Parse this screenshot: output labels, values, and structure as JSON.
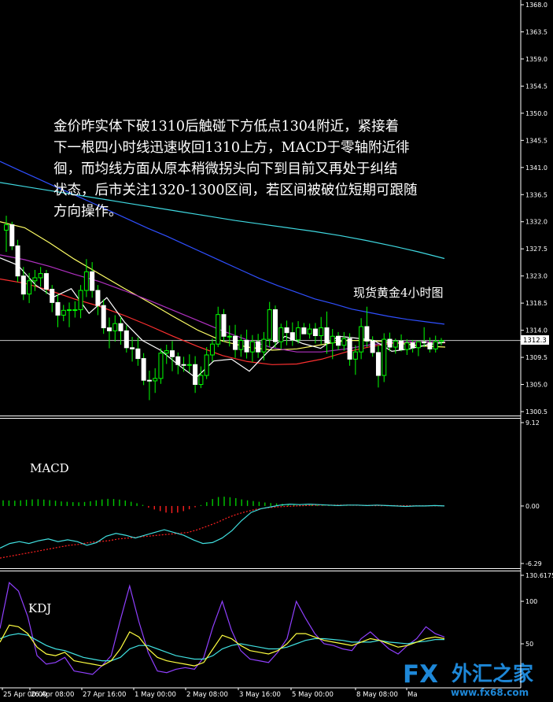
{
  "chart_data": {
    "type": "candlestick",
    "instrument_label": "现货黄金4小时图",
    "annotation": [
      "金价昨实体下破1310后触碰下方低点1304附近，紧接着",
      "下一根四小时线迅速收回1310上方，MACD于零轴附近徘",
      "徊，而均线方面从原本稍微拐头向下到目前又再处于纠结",
      "状态，后市关注1320-1300区间，若区间被破位短期可跟随",
      "方向操作。"
    ],
    "current_price_label": "1312.3",
    "current_price": 1312.3,
    "price_axis": {
      "range": [
        1300.5,
        1368.0
      ],
      "ticks": [
        "1368.0",
        "1363.5",
        "1359.0",
        "1354.5",
        "1350.0",
        "1345.5",
        "1341.0",
        "1336.5",
        "1332.0",
        "1327.5",
        "1323.0",
        "1318.5",
        "1314.0",
        "1309.5",
        "1305.0",
        "1300.5"
      ]
    },
    "x_axis_labels": [
      "25 Apr 00:00",
      "26 Apr 08:00",
      "27 Apr 16:00",
      "1 May 00:00",
      "2 May 08:00",
      "3 May 16:00",
      "5 May 00:00",
      "8 May 08:00",
      "Ma"
    ],
    "candles": [
      [
        1330.6,
        1333.0,
        1327.0,
        1331.5
      ],
      [
        1331.5,
        1332.0,
        1327.3,
        1328.0
      ],
      [
        1328.0,
        1329.0,
        1322.0,
        1323.0
      ],
      [
        1323.0,
        1324.5,
        1319.0,
        1320.0
      ],
      [
        1320.0,
        1323.5,
        1318.5,
        1322.2
      ],
      [
        1322.2,
        1324.0,
        1320.5,
        1322.7
      ],
      [
        1322.7,
        1324.5,
        1321.2,
        1323.4
      ],
      [
        1323.4,
        1324.0,
        1320.0,
        1320.8
      ],
      [
        1320.8,
        1321.5,
        1317.0,
        1318.6
      ],
      [
        1318.6,
        1320.0,
        1314.5,
        1316.5
      ],
      [
        1316.5,
        1318.2,
        1315.5,
        1317.3
      ],
      [
        1317.3,
        1318.6,
        1314.5,
        1317.4
      ],
      [
        1317.4,
        1318.8,
        1316.1,
        1317.4
      ],
      [
        1317.4,
        1321.5,
        1316.0,
        1320.6
      ],
      [
        1320.6,
        1325.8,
        1319.5,
        1323.7
      ],
      [
        1323.7,
        1325.3,
        1319.4,
        1320.6
      ],
      [
        1320.6,
        1321.5,
        1316.5,
        1318.1
      ],
      [
        1318.1,
        1319.1,
        1313.4,
        1314.4
      ],
      [
        1314.4,
        1316.1,
        1311.0,
        1313.9
      ],
      [
        1313.9,
        1316.5,
        1312.1,
        1315.1
      ],
      [
        1315.1,
        1316.2,
        1311.6,
        1313.9
      ],
      [
        1313.9,
        1314.8,
        1310.3,
        1311.1
      ],
      [
        1311.1,
        1312.9,
        1308.8,
        1310.9
      ],
      [
        1310.9,
        1312.8,
        1308.1,
        1309.3
      ],
      [
        1309.3,
        1310.2,
        1304.9,
        1305.7
      ],
      [
        1305.7,
        1307.3,
        1302.4,
        1305.6
      ],
      [
        1305.6,
        1307.7,
        1303.6,
        1306.0
      ],
      [
        1306.0,
        1311.0,
        1305.1,
        1310.2
      ],
      [
        1310.2,
        1311.6,
        1308.4,
        1310.6
      ],
      [
        1310.6,
        1312.2,
        1307.2,
        1309.6
      ],
      [
        1309.6,
        1310.3,
        1306.7,
        1308.3
      ],
      [
        1308.3,
        1309.6,
        1307.1,
        1308.2
      ],
      [
        1308.2,
        1310.0,
        1307.0,
        1308.3
      ],
      [
        1308.3,
        1309.7,
        1303.6,
        1305.0
      ],
      [
        1305.0,
        1308.0,
        1304.4,
        1306.5
      ],
      [
        1306.5,
        1311.2,
        1305.9,
        1309.9
      ],
      [
        1309.9,
        1312.6,
        1308.8,
        1311.7
      ],
      [
        1311.7,
        1317.9,
        1311.2,
        1316.6
      ],
      [
        1316.6,
        1317.5,
        1312.1,
        1313.0
      ],
      [
        1313.0,
        1314.8,
        1311.3,
        1313.0
      ],
      [
        1313.0,
        1314.9,
        1309.4,
        1310.8
      ],
      [
        1310.8,
        1313.3,
        1309.6,
        1312.3
      ],
      [
        1312.3,
        1314.1,
        1309.3,
        1310.4
      ],
      [
        1310.4,
        1313.2,
        1308.7,
        1312.1
      ],
      [
        1312.1,
        1313.4,
        1309.4,
        1310.4
      ],
      [
        1310.4,
        1313.7,
        1309.0,
        1312.5
      ],
      [
        1312.5,
        1318.7,
        1311.2,
        1317.4
      ],
      [
        1317.4,
        1318.1,
        1311.1,
        1312.1
      ],
      [
        1312.1,
        1315.1,
        1310.9,
        1314.4
      ],
      [
        1314.4,
        1315.6,
        1311.5,
        1313.6
      ],
      [
        1313.6,
        1315.3,
        1311.4,
        1312.4
      ],
      [
        1312.4,
        1315.5,
        1311.8,
        1314.4
      ],
      [
        1314.4,
        1315.2,
        1313.4,
        1313.4
      ],
      [
        1313.4,
        1315.1,
        1312.6,
        1314.2
      ],
      [
        1314.2,
        1315.2,
        1311.8,
        1313.1
      ],
      [
        1313.1,
        1316.2,
        1311.7,
        1314.4
      ],
      [
        1314.4,
        1317.1,
        1310.1,
        1311.9
      ],
      [
        1311.9,
        1314.2,
        1309.2,
        1313.0
      ],
      [
        1313.0,
        1313.7,
        1310.7,
        1311.5
      ],
      [
        1311.5,
        1313.7,
        1310.6,
        1312.6
      ],
      [
        1312.6,
        1313.5,
        1308.1,
        1309.2
      ],
      [
        1309.2,
        1311.5,
        1306.6,
        1310.4
      ],
      [
        1310.4,
        1316.0,
        1309.2,
        1314.6
      ],
      [
        1314.6,
        1317.9,
        1311.2,
        1312.2
      ],
      [
        1312.2,
        1313.0,
        1309.6,
        1310.3
      ],
      [
        1310.3,
        1311.5,
        1304.5,
        1306.5
      ],
      [
        1306.5,
        1313.5,
        1305.4,
        1312.5
      ],
      [
        1312.5,
        1313.6,
        1310.5,
        1311.2
      ],
      [
        1311.2,
        1312.6,
        1310.1,
        1312.2
      ],
      [
        1312.2,
        1313.3,
        1310.5,
        1310.8
      ],
      [
        1310.8,
        1312.5,
        1309.9,
        1311.9
      ],
      [
        1311.9,
        1312.4,
        1310.3,
        1311.1
      ],
      [
        1311.1,
        1312.1,
        1309.7,
        1312.1
      ],
      [
        1312.1,
        1314.5,
        1311.2,
        1311.9
      ],
      [
        1311.9,
        1312.8,
        1310.3,
        1310.9
      ],
      [
        1310.9,
        1313.1,
        1310.3,
        1312.1
      ],
      [
        1312.1,
        1312.7,
        1311.5,
        1312.3
      ]
    ],
    "moving_averages": [
      {
        "color": "#2f4fff",
        "values": [
          1342.0,
          1340.6,
          1339.2,
          1337.8,
          1336.5,
          1335.1,
          1333.7,
          1332.3,
          1330.9,
          1329.6,
          1328.2,
          1326.8,
          1325.4,
          1324.0,
          1322.6,
          1321.4,
          1320.3,
          1319.2,
          1318.4,
          1317.5,
          1316.9,
          1316.3,
          1315.8,
          1315.4,
          1315.0
        ]
      },
      {
        "color": "#3fd8e0",
        "values": [
          1338.5,
          1337.8,
          1337.1,
          1336.4,
          1335.7,
          1335.0,
          1334.3,
          1333.6,
          1332.9,
          1332.2,
          1331.6,
          1331.0,
          1330.4,
          1329.7,
          1328.9,
          1328.0,
          1327.0,
          1325.9
        ]
      },
      {
        "color": "#ffff66",
        "values": [
          1332.0,
          1331.0,
          1328.5,
          1325.8,
          1323.4,
          1321.0,
          1318.7,
          1316.3,
          1314.0,
          1312.2,
          1311.2,
          1310.7,
          1310.9,
          1311.6,
          1312.3,
          1312.3,
          1311.9,
          1311.4,
          1311.2
        ]
      },
      {
        "color": "#ff3030",
        "values": [
          1322.5,
          1321.8,
          1320.6,
          1319.2,
          1318.0,
          1316.5,
          1314.8,
          1313.0,
          1311.3,
          1309.8,
          1308.8,
          1308.3,
          1308.4,
          1309.2,
          1310.4,
          1311.3,
          1311.9,
          1312.1,
          1311.9
        ]
      },
      {
        "color": "#b030c0",
        "values": [
          1326.5,
          1325.7,
          1324.6,
          1323.3,
          1322.1,
          1320.6,
          1319.0,
          1317.3,
          1315.6,
          1313.9,
          1312.4,
          1311.1,
          1310.4,
          1310.4,
          1310.9,
          1311.6,
          1312.0,
          1312.1,
          1312.0
        ]
      },
      {
        "color": "#ffffff",
        "values": [
          1326.0,
          1324.8,
          1321.5,
          1319.5,
          1320.9,
          1316.8,
          1319.4,
          1315.3,
          1312.3,
          1310.7,
          1308.3,
          1306.1,
          1308.9,
          1309.2,
          1307.2,
          1310.3,
          1313.0,
          1311.8,
          1311.0,
          1313.0,
          1312.7,
          1312.3,
          1310.5,
          1310.9,
          1311.6,
          1312.0
        ]
      }
    ],
    "macd": {
      "label": "MACD",
      "axis_ticks": [
        "9.12",
        "0.00",
        "-6.29"
      ],
      "range": [
        -6.29,
        9.12
      ],
      "histogram": [
        0.62,
        0.6,
        0.58,
        0.62,
        0.68,
        0.72,
        0.74,
        0.7,
        0.64,
        0.58,
        0.5,
        0.46,
        0.42,
        0.4,
        0.44,
        0.52,
        0.62,
        0.72,
        0.78,
        0.76,
        0.7,
        0.6,
        0.46,
        0.3,
        0.12,
        -0.18,
        -0.38,
        -0.56,
        -0.72,
        -0.78,
        -0.72,
        -0.56,
        -0.36,
        -0.14,
        0.1,
        0.42,
        0.76,
        0.98,
        1.02,
        0.96,
        0.86,
        0.72,
        0.62,
        0.54,
        0.46,
        0.38,
        0.32,
        0.28,
        0.24,
        0.2,
        0.16,
        0.14,
        0.12,
        0.1,
        0.08,
        0.06,
        0.05,
        0.04,
        0.03,
        0.02,
        0.01,
        0.0,
        0.0,
        -0.01,
        -0.02,
        -0.03,
        -0.03,
        -0.02,
        -0.01,
        0.0,
        0.0,
        0.01,
        0.0,
        0.0,
        0.0,
        0.0,
        0.0
      ],
      "macd_line": [
        -4.6,
        -4.1,
        -3.9,
        -4.1,
        -3.8,
        -3.6,
        -3.9,
        -3.7,
        -3.9,
        -4.3,
        -4.0,
        -3.3,
        -3.0,
        -3.2,
        -3.5,
        -3.2,
        -2.9,
        -2.6,
        -2.9,
        -3.2,
        -3.7,
        -4.1,
        -4.0,
        -3.5,
        -2.7,
        -1.6,
        -0.7,
        -0.3,
        -0.1,
        0.1,
        0.2,
        0.15,
        0.2,
        0.15,
        0.1,
        0.05,
        0.1,
        0.1,
        0.05,
        0.1,
        0.05,
        0.0,
        -0.05,
        0.0,
        0.0,
        0.05,
        0.0
      ],
      "signal_line": [
        -5.7,
        -5.5,
        -5.3,
        -5.1,
        -4.9,
        -4.7,
        -4.5,
        -4.3,
        -4.2,
        -4.0,
        -3.9,
        -3.8,
        -3.6,
        -3.5,
        -3.4,
        -3.3,
        -3.2,
        -3.1,
        -3.0,
        -2.9,
        -2.6,
        -2.2,
        -1.8,
        -1.3,
        -0.9,
        -0.6,
        -0.35,
        -0.2,
        -0.1,
        -0.05,
        0.0,
        0.05,
        0.08,
        0.1,
        0.1,
        0.1,
        0.08,
        0.06,
        0.05,
        0.05,
        0.04,
        0.03,
        0.02,
        0.02,
        0.02,
        0.02
      ]
    },
    "kdj": {
      "label": "KDJ",
      "axis_ticks": [
        "130.6175",
        "100",
        "50"
      ],
      "range": [
        0,
        130.6175
      ],
      "k": [
        52,
        72,
        70,
        62,
        46,
        38,
        36,
        40,
        30,
        28,
        26,
        24,
        30,
        44,
        64,
        58,
        44,
        34,
        30,
        28,
        26,
        24,
        28,
        44,
        60,
        56,
        48,
        42,
        40,
        38,
        42,
        50,
        62,
        62,
        58,
        54,
        52,
        50,
        48,
        52,
        56,
        54,
        50,
        46,
        48,
        52,
        56,
        58,
        56
      ],
      "d": [
        56,
        60,
        62,
        60,
        54,
        48,
        44,
        42,
        38,
        34,
        32,
        30,
        30,
        34,
        44,
        48,
        48,
        44,
        40,
        36,
        34,
        32,
        32,
        36,
        44,
        48,
        50,
        48,
        46,
        44,
        44,
        46,
        50,
        54,
        56,
        56,
        55,
        54,
        52,
        52,
        52,
        54,
        52,
        51,
        50,
        52,
        53,
        55,
        55
      ],
      "j": [
        68,
        122,
        112,
        82,
        36,
        26,
        28,
        34,
        18,
        16,
        14,
        24,
        36,
        78,
        118,
        76,
        40,
        18,
        16,
        20,
        22,
        20,
        34,
        70,
        100,
        66,
        42,
        32,
        30,
        28,
        40,
        56,
        100,
        80,
        62,
        50,
        48,
        44,
        42,
        56,
        64,
        54,
        44,
        38,
        48,
        56,
        70,
        62,
        58
      ]
    }
  },
  "watermark": {
    "fx": "FX",
    "name": "外汇之家",
    "url": "www.fx68.com"
  }
}
